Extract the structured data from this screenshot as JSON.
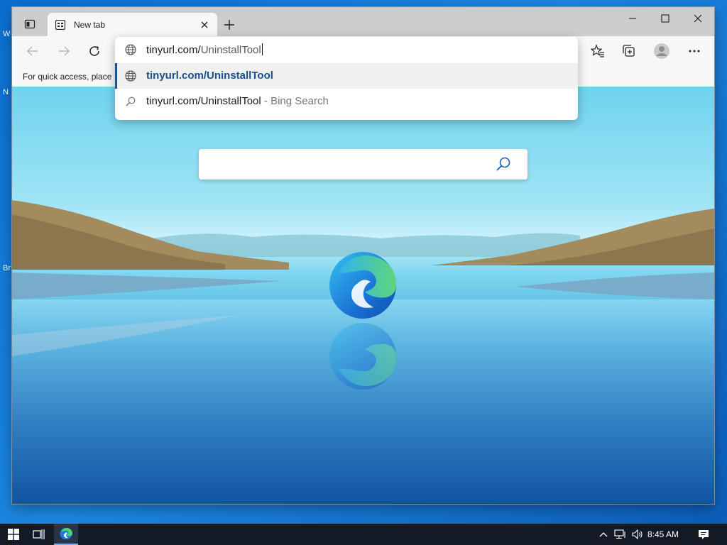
{
  "desktop": {
    "labels": [
      "W",
      "N",
      "Br"
    ]
  },
  "browser": {
    "tab": {
      "title": "New tab"
    },
    "favorites_bar": {
      "text": "For quick access, place y"
    },
    "address_bar": {
      "typed": "tinyurl.com/",
      "completion": "UninstallTool"
    },
    "suggestions": [
      {
        "text": "tinyurl.com/UninstallTool",
        "suffix": "",
        "icon": "globe-icon",
        "selected": true
      },
      {
        "text": "tinyurl.com/UninstallTool",
        "suffix": " - Bing Search",
        "icon": "search-icon",
        "selected": false
      }
    ]
  },
  "taskbar": {
    "clock": "8:45 AM"
  },
  "colors": {
    "accent": "#1a4f8b",
    "taskbar": "#131a26",
    "titlebar": "#cccccc"
  }
}
